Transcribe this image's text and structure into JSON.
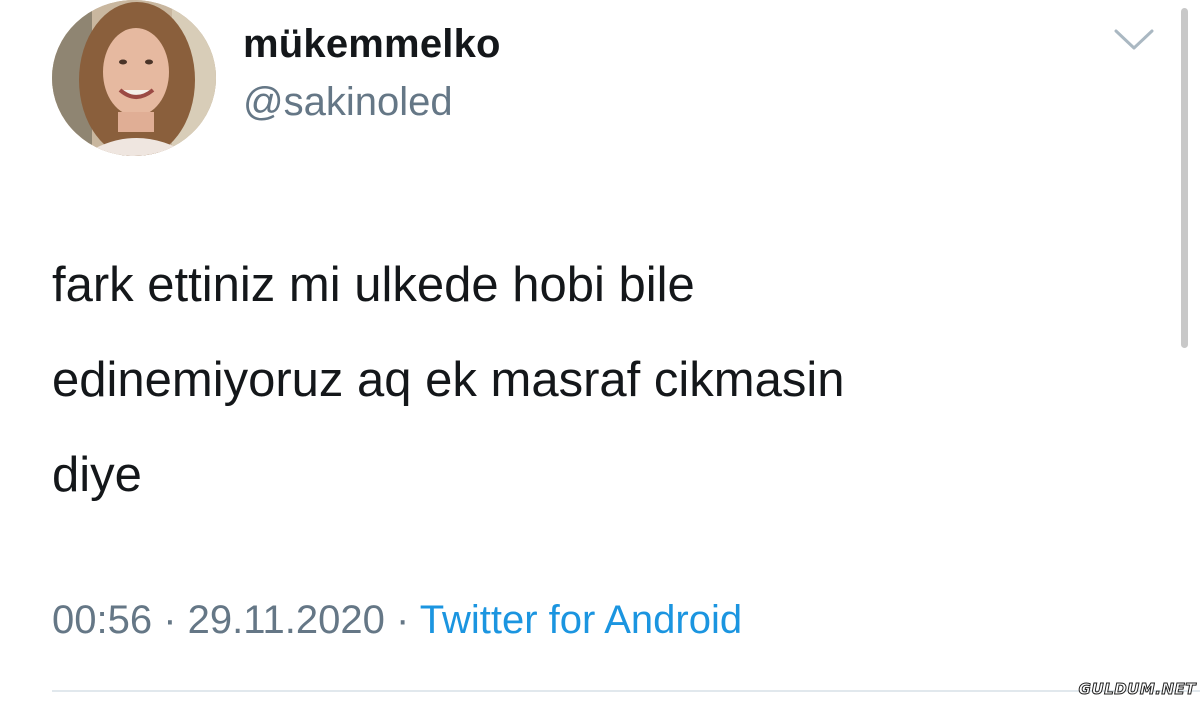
{
  "user": {
    "display_name": "mükemmelko",
    "handle": "@sakinoled"
  },
  "tweet": {
    "lines": [
      "fark ettiniz mi ulkede hobi bile",
      "edinemiyoruz aq ek masraf cikmasin",
      "diye"
    ]
  },
  "meta": {
    "time": "00:56",
    "separator": " · ",
    "date": "29.11.2020",
    "source": "Twitter for Android"
  },
  "icons": {
    "menu": "chevron-down-icon"
  },
  "watermark": "GULDUM.NET",
  "colors": {
    "text_primary": "#14171a",
    "text_secondary": "#657786",
    "link": "#1b95e0",
    "divider": "#e1e8ed"
  }
}
